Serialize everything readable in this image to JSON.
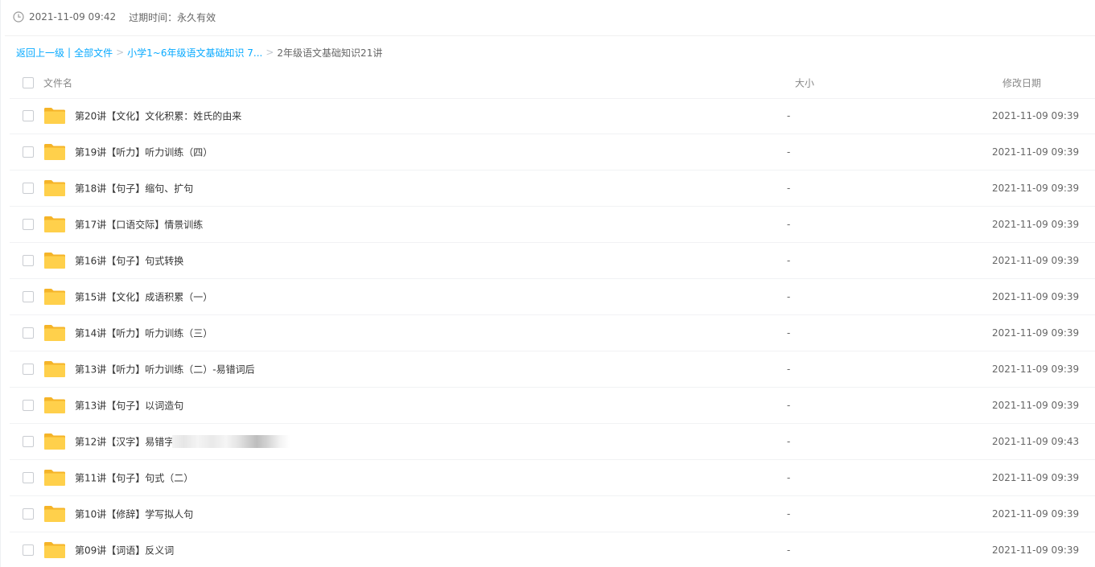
{
  "meta": {
    "created": "2021-11-09 09:42",
    "expire_label": "过期时间：永久有效"
  },
  "breadcrumb": {
    "back": "返回上一级",
    "bar": "|",
    "all_files": "全部文件",
    "sep": ">",
    "parent": "小学1~6年级语文基础知识 7...",
    "current": "2年级语文基础知识21讲"
  },
  "table": {
    "columns": {
      "name": "文件名",
      "size": "大小",
      "modified": "修改日期"
    },
    "rows": [
      {
        "name": "第20讲【文化】文化积累：姓氏的由来",
        "size": "-",
        "modified": "2021-11-09 09:39"
      },
      {
        "name": "第19讲【听力】听力训练（四）",
        "size": "-",
        "modified": "2021-11-09 09:39"
      },
      {
        "name": "第18讲【句子】缩句、扩句",
        "size": "-",
        "modified": "2021-11-09 09:39"
      },
      {
        "name": "第17讲【口语交际】情景训练",
        "size": "-",
        "modified": "2021-11-09 09:39"
      },
      {
        "name": "第16讲【句子】句式转换",
        "size": "-",
        "modified": "2021-11-09 09:39"
      },
      {
        "name": "第15讲【文化】成语积累（一）",
        "size": "-",
        "modified": "2021-11-09 09:39"
      },
      {
        "name": "第14讲【听力】听力训练（三）",
        "size": "-",
        "modified": "2021-11-09 09:39"
      },
      {
        "name": "第13讲【听力】听力训练（二）-易错词后",
        "size": "-",
        "modified": "2021-11-09 09:39"
      },
      {
        "name": "第13讲【句子】以词造句",
        "size": "-",
        "modified": "2021-11-09 09:39"
      },
      {
        "name": "第12讲【汉字】易错字",
        "size": "-",
        "modified": "2021-11-09 09:43"
      },
      {
        "name": "第11讲【句子】句式（二）",
        "size": "-",
        "modified": "2021-11-09 09:39"
      },
      {
        "name": "第10讲【修辞】学写拟人句",
        "size": "-",
        "modified": "2021-11-09 09:39"
      },
      {
        "name": "第09讲【词语】反义词",
        "size": "-",
        "modified": "2021-11-09 09:39"
      }
    ]
  },
  "icons": {
    "clock": "clock-icon",
    "folder": "folder-icon"
  },
  "colors": {
    "link": "#09aaff",
    "folder": "#ffd04b",
    "folder_tab": "#f5b428"
  }
}
